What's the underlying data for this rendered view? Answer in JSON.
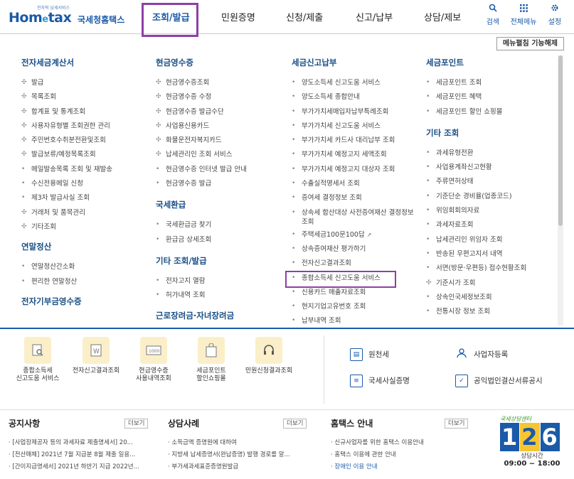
{
  "header": {
    "logo_main": "Hom",
    "logo_e": "e",
    "logo_tax": "tax",
    "logo_sub": "전자적 납세서비스",
    "logo_kr": "국세청홈택스",
    "nav": [
      "조회/발급",
      "민원증명",
      "신청/제출",
      "신고/납부",
      "상담/제보"
    ],
    "tools": [
      {
        "label": "검색",
        "icon": "search-icon"
      },
      {
        "label": "전체메뉴",
        "icon": "grid-icon"
      },
      {
        "label": "설정",
        "icon": "gear-icon"
      }
    ]
  },
  "menu_toggle": "메뉴펼침 기능해제",
  "col1": {
    "cat1": "전자세금계산서",
    "items1": [
      "발급",
      "목록조회",
      "합계표 및 통계조회",
      "사용자유형별 조회권한 관리",
      "주민번호수취분전환및조회",
      "발급보류/예정목록조회",
      "메일발송목록 조회 및 재발송",
      "수신전용메일 신청",
      "제3자 발급사실 조회",
      "거래처 및 품목관리",
      "기타조회"
    ],
    "cat2": "연말정산",
    "items2": [
      "연말정산간소화",
      "편리한 연말정산"
    ],
    "cat3": "전자기부금영수증"
  },
  "col2": {
    "cat1": "현금영수증",
    "items1": [
      "현금영수증조회",
      "현금영수증 수정",
      "현금영수증 발급수단",
      "사업용신용카드",
      "화물운전자복지카드",
      "납세관리인 조회 서비스",
      "현금영수증 인터넷 발급 안내",
      "현금영수증 발급"
    ],
    "cat2": "국세환급",
    "items2": [
      "국세환급금 찾기",
      "환급금 상세조회"
    ],
    "cat3": "기타 조회/발급",
    "items3": [
      "전자고지 열람",
      "허가내역 조회"
    ],
    "cat4": "근로장려금·자녀장려금"
  },
  "col3": {
    "cat1": "세금신고납부",
    "items": [
      "양도소득세 신고도움 서비스",
      "양도소득세 종합안내",
      "부가가치세매입자납부특례조회",
      "부가가치세 신고도움 서비스",
      "부가가치세 카드사 대리납부 조회",
      "부가가치세 예정고지 세액조회",
      "부가가치세 예정고지 대상자 조회",
      "수출실적명세서 조회",
      "증여세 결정정보 조회",
      "상속세 합산대상 사전증여재산 결정정보 조회",
      "주택세금100문100답",
      "상속증여재산 평가하기",
      "전자신고결과조회",
      "종합소득세 신고도움 서비스",
      "신용카드 매출자료조회",
      "현지기업고유번호 조회",
      "납부내역 조회"
    ]
  },
  "col4": {
    "cat1": "세금포인트",
    "items1": [
      "세금포인트 조회",
      "세금포인트 혜택",
      "세금포인트 할인 쇼핑몰"
    ],
    "cat2": "기타 조회",
    "items2": [
      "과세유형전환",
      "사업용계좌신고현황",
      "주류면허상태",
      "기준단순 경비율(업종코드)",
      "위임회회의자료",
      "과세자료조회",
      "납세관리인 위임자 조회",
      "반송된 우편고지서 내역",
      "서면(방문·우편등) 접수현황조회",
      "기준시가 조회",
      "상속인국세정보조회",
      "전통시장 정보 조회"
    ]
  },
  "quick": [
    {
      "label1": "종합소득세",
      "label2": "신고도움 서비스",
      "icon": "document-search-icon"
    },
    {
      "label1": "전자신고결과조회",
      "label2": "",
      "icon": "document-w-icon"
    },
    {
      "label1": "현금영수증",
      "label2": "사용내역조회",
      "icon": "receipt-icon"
    },
    {
      "label1": "세금포인트",
      "label2": "할인쇼핑몰",
      "icon": "shopping-bag-icon"
    },
    {
      "label1": "민원신청결과조회",
      "label2": "",
      "icon": "headset-icon"
    }
  ],
  "services": [
    {
      "label": "원천세",
      "icon": "calendar-doc-icon"
    },
    {
      "label": "사업자등록",
      "icon": "person-icon"
    },
    {
      "label": "국세사실증명",
      "icon": "certificate-icon"
    },
    {
      "label": "공익법인결산서류공시",
      "icon": "checklist-icon"
    }
  ],
  "notice": {
    "title": "공지사항",
    "more": "더보기",
    "items": [
      "[사업장제공자 등의 과세자료 제출명세서] 20...",
      "[전산매체] 2021년 7월 지급분 8월 제출 일용...",
      "[간이지급명세서] 2021년 하반기 지급 2022년..."
    ]
  },
  "cases": {
    "title": "상담사례",
    "more": "더보기",
    "items": [
      "소득금액 증명원에 대하여",
      "지방세 납세증명서(완납증명) 발행 경로를 알...",
      "부가세과세표준증명원발급"
    ]
  },
  "guide": {
    "title": "홈택스 안내",
    "more": "더보기",
    "items": [
      "신규사업자를 위한 홈택스 이용안내",
      "홈택스 이용에 관한 안내",
      "장애인 이용 안내"
    ]
  },
  "callcenter": {
    "title": "국세상담센터",
    "num": [
      "1",
      "2",
      "6"
    ],
    "hours_label": "상담시간",
    "hours": "09:00 ~ 18:00"
  }
}
